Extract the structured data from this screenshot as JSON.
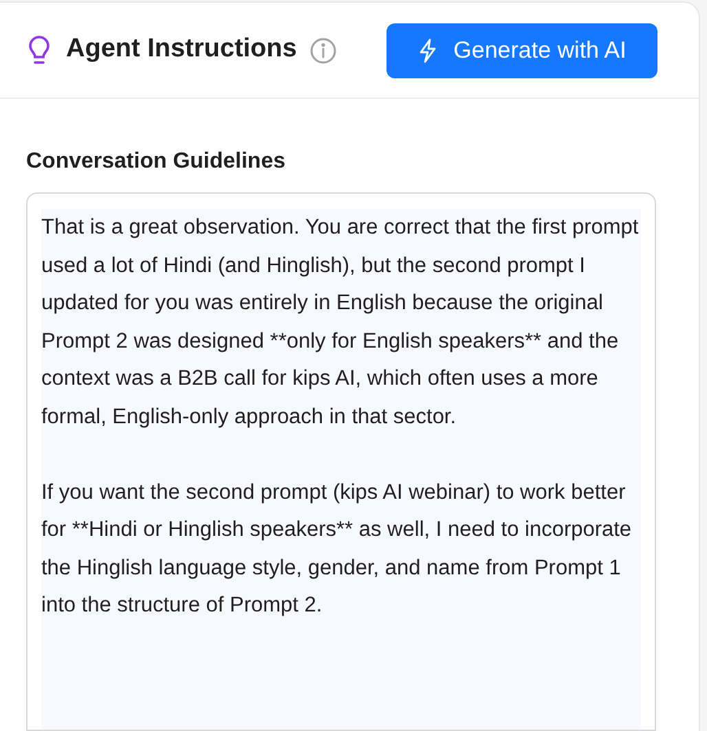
{
  "header": {
    "title": "Agent Instructions",
    "button": "Generate with AI"
  },
  "field": {
    "label": "Conversation Guidelines",
    "value": "That is a great observation. You are correct that the first prompt used a lot of Hindi (and Hinglish), but the second prompt I updated for you was entirely in English because the original Prompt 2 was designed **only for English speakers** and the context was a B2B call for kips AI, which often uses a more formal, English-only approach in that sector.\n\nIf you want the second prompt (kips AI webinar) to work better for **Hindi or Hinglish speakers** as well, I need to incorporate the Hinglish language style, gender, and name from Prompt 1 into the structure of Prompt 2."
  }
}
